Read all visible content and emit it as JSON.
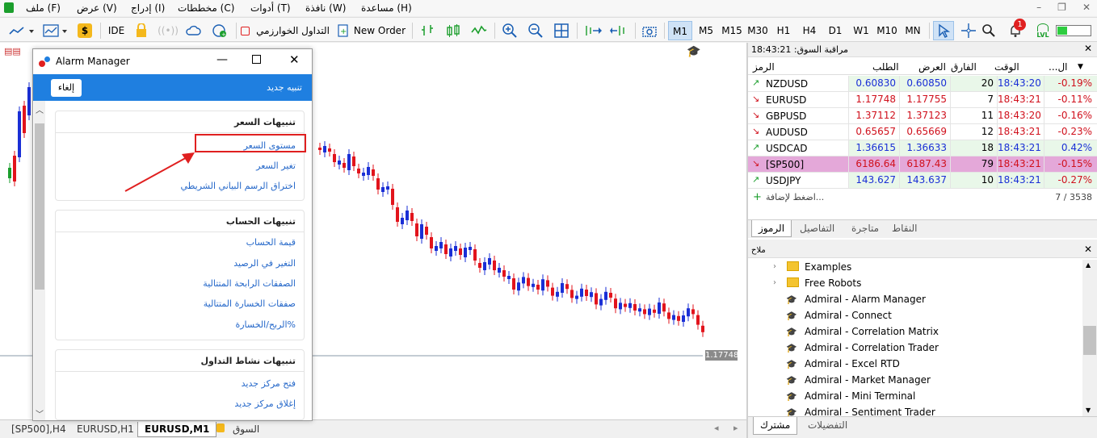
{
  "menu": [
    "ملف (F)",
    "عرض (V)",
    "إدراج (I)",
    "مخططات (C)",
    "أدوات (T)",
    "نافذة (W)",
    "مساعدة (H)"
  ],
  "toolbar": {
    "ide": "IDE",
    "algo_trading": "التداول الخوارزمي",
    "new_order": "New Order",
    "timeframes": [
      "M1",
      "M5",
      "M15",
      "M30",
      "H1",
      "H4",
      "D1",
      "W1",
      "M10",
      "MN"
    ],
    "active_timeframe": "M1",
    "notification_count": "1",
    "lvl": "LVL"
  },
  "chart": {
    "price_label": "1.17748",
    "tabs": [
      "[SP500],H4",
      "EURUSD,H1",
      "EURUSD,M1"
    ],
    "active_tab": "EURUSD,M1",
    "market_tab": "السوق"
  },
  "alarm_manager": {
    "title": "Alarm Manager",
    "new_alert": "تنبيه جديد",
    "cancel": "إلغاء",
    "sections": [
      {
        "header": "تنبيهات السعر",
        "items": [
          "مستوى السعر",
          "تغير السعر",
          "اختراق الرسم البياني الشريطي"
        ]
      },
      {
        "header": "تنبيهات الحساب",
        "items": [
          "قيمة الحساب",
          "التغير في الرصيد",
          "الصفقات الرابحة المتتالية",
          "صفقات الخسارة المتتالية",
          "الربح/الخسارة%"
        ]
      },
      {
        "header": "تنبيهات نشاط التداول",
        "items": [
          "فتح مركز جديد",
          "إغلاق مركز جديد"
        ]
      }
    ]
  },
  "market_watch": {
    "title": "مراقبة السوق: 18:43:21",
    "columns": [
      "الرمز",
      "الطلب",
      "العرض",
      "الفارق",
      "الوقت",
      "...ال"
    ],
    "rows": [
      {
        "symbol": "NZDUSD",
        "bid": "0.60830",
        "ask": "0.60850",
        "spread": "20",
        "time": "18:43:20",
        "change": "-0.19%",
        "dir": "up"
      },
      {
        "symbol": "EURUSD",
        "bid": "1.17748",
        "ask": "1.17755",
        "spread": "7",
        "time": "18:43:21",
        "change": "-0.11%",
        "dir": "down"
      },
      {
        "symbol": "GBPUSD",
        "bid": "1.37112",
        "ask": "1.37123",
        "spread": "11",
        "time": "18:43:20",
        "change": "-0.16%",
        "dir": "down"
      },
      {
        "symbol": "AUDUSD",
        "bid": "0.65657",
        "ask": "0.65669",
        "spread": "12",
        "time": "18:43:21",
        "change": "-0.23%",
        "dir": "down"
      },
      {
        "symbol": "USDCAD",
        "bid": "1.36615",
        "ask": "1.36633",
        "spread": "18",
        "time": "18:43:21",
        "change": "0.42%",
        "dir": "up"
      },
      {
        "symbol": "[SP500]",
        "bid": "6186.64",
        "ask": "6187.43",
        "spread": "79",
        "time": "18:43:21",
        "change": "-0.15%",
        "dir": "down"
      },
      {
        "symbol": "USDJPY",
        "bid": "143.627",
        "ask": "143.637",
        "spread": "10",
        "time": "18:43:21",
        "change": "-0.27%",
        "dir": "up"
      }
    ],
    "add_label": "اضغط لإضافة...",
    "count": "7 / 3538",
    "tabs": [
      "الرموز",
      "التفاصيل",
      "متاجرة",
      "النقاط"
    ],
    "active_tab": "الرموز"
  },
  "navigator": {
    "title": "ملاح",
    "folders": [
      "Examples",
      "Free Robots"
    ],
    "items": [
      "Admiral - Alarm Manager",
      "Admiral - Connect",
      "Admiral - Correlation Matrix",
      "Admiral - Correlation Trader",
      "Admiral - Excel RTD",
      "Admiral - Market Manager",
      "Admiral - Mini Terminal",
      "Admiral - Sentiment Trader"
    ],
    "tabs": [
      "مشترك",
      "التفضيلات"
    ],
    "active_tab": "مشترك"
  },
  "colors": {
    "accent": "#1f7fe0",
    "bull": "#1a2fd6",
    "bear": "#e2141c",
    "highlight_red": "#e02020"
  }
}
